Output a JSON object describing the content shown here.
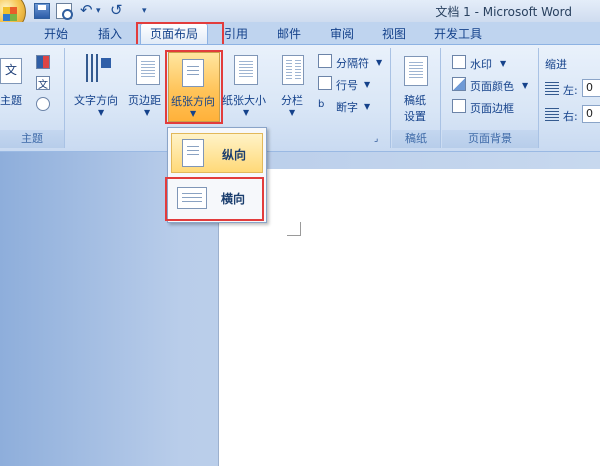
{
  "window": {
    "title": "文档 1 - Microsoft Word"
  },
  "qat": {
    "separator": "▾",
    "undo_glyph": "↶",
    "redo_glyph": "↺"
  },
  "tabs": [
    "开始",
    "插入",
    "页面布局",
    "引用",
    "邮件",
    "审阅",
    "视图",
    "开发工具"
  ],
  "active_tab": "页面布局",
  "ribbon": {
    "theme": {
      "btn_label": "主题",
      "group_label": "主题",
      "doc_glyph": "文",
      "font_glyph": "文"
    },
    "page_setup": {
      "text_direction": "文字方向",
      "margins": "页边距",
      "orientation": "纸张方向",
      "size": "纸张大小",
      "columns": "分栏",
      "breaks": "分隔符",
      "line_numbers": "行号",
      "hyphenation": "断字",
      "hyphenation_prefix": "b",
      "launcher_glyph": "⌟"
    },
    "draft": {
      "line1": "稿纸",
      "line2": "设置",
      "group_label": "稿纸"
    },
    "page_background": {
      "watermark": "水印",
      "page_color": "页面颜色",
      "page_borders": "页面边框",
      "group_label": "页面背景"
    },
    "indent": {
      "title": "缩进",
      "left": "左:",
      "right": "右:",
      "left_value": "0",
      "right_value": "0"
    }
  },
  "orientation_menu": {
    "items": [
      {
        "label": "纵向",
        "selected": true
      },
      {
        "label": "横向",
        "selected": false
      }
    ]
  },
  "colors": {
    "highlight_box": "#e23c3c",
    "selected_item": "#ffd978"
  }
}
